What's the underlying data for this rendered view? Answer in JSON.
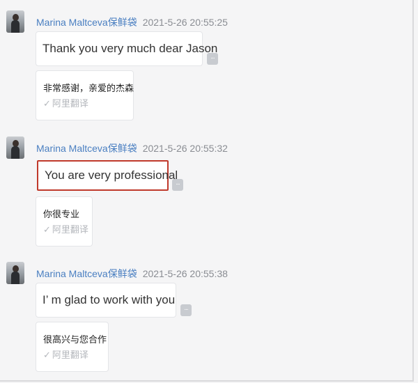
{
  "messages": [
    {
      "sender": "Marina Maltceva保鲜袋",
      "time": "2021-5-26 20:55:25",
      "text": "Thank you very much dear Jason",
      "translation": "非常感谢，亲爱的杰森",
      "translation_source": "阿里翻译",
      "highlighted": false
    },
    {
      "sender": "Marina Maltceva保鲜袋",
      "time": "2021-5-26 20:55:32",
      "text": "You are very professional",
      "translation": "你很专业",
      "translation_source": "阿里翻译",
      "highlighted": true
    },
    {
      "sender": "Marina Maltceva保鲜袋",
      "time": "2021-5-26 20:55:38",
      "text": "I’ m glad to work with you",
      "translation": "很高兴与您合作",
      "translation_source": "阿里翻译",
      "highlighted": false
    }
  ],
  "ui": {
    "more_button_glyph": "...",
    "check_glyph": "✓",
    "highlight_color": "#c0392b",
    "sender_color": "#4a7fc1"
  }
}
